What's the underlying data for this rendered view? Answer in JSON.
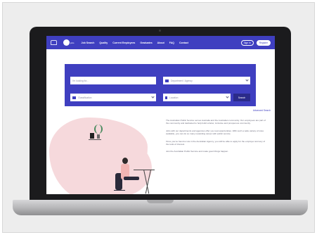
{
  "nav": {
    "logo_text": "jobs",
    "links": [
      "Job Search",
      "Quality",
      "Current Employees",
      "Graduates",
      "About",
      "FAQ",
      "Contact"
    ],
    "sign_in": "Sign in",
    "register": "Register"
  },
  "search": {
    "keyword_placeholder": "I'm looking for...",
    "department_placeholder": "Department / Agency",
    "classification_placeholder": "Classification",
    "location_placeholder": "Location",
    "search_button": "Search",
    "advanced_link": "Advanced Search"
  },
  "content": {
    "paragraphs": [
      "The Australian Public Service serves Australia and the Australian community. Our employees are part of the community and dedicated to help build a fairer, inclusive and prosperous community.",
      "Jobs with our departments and agencies offer you real opportunities. With such a wide variety of roles available, you can do so many rewarding career with public service.",
      "Once you've found a role in the Australian Agency, you will be able to apply for the employer and any of the tools of interest.",
      "Join the Australian Public Service and make good things happen."
    ]
  },
  "colors": {
    "primary": "#3f3fc0",
    "accent_pink": "#f6d9dc"
  }
}
